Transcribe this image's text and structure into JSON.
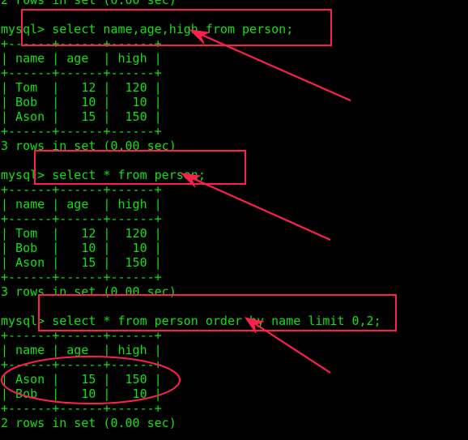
{
  "terminal": {
    "prompt": "mysql>",
    "partial_top_line": "2 rows in set (0.00 sec)",
    "queries": [
      {
        "command": "select name,age,high from person;",
        "columns": [
          "name",
          "age",
          "high"
        ],
        "rows": [
          [
            "Tom",
            "12",
            "120"
          ],
          [
            "Bob",
            "10",
            "10"
          ],
          [
            "Ason",
            "15",
            "150"
          ]
        ],
        "status": "3 rows in set (0.00 sec)"
      },
      {
        "command": "select * from person;",
        "columns": [
          "name",
          "age",
          "high"
        ],
        "rows": [
          [
            "Tom",
            "12",
            "120"
          ],
          [
            "Bob",
            "10",
            "10"
          ],
          [
            "Ason",
            "15",
            "150"
          ]
        ],
        "status": "3 rows in set (0.00 sec)"
      },
      {
        "command": "select * from person order by name limit 0,2;",
        "columns": [
          "name",
          "age",
          "high"
        ],
        "rows": [
          [
            "Ason",
            "15",
            "150"
          ],
          [
            "Bob",
            "10",
            "10"
          ]
        ],
        "status": "2 rows in set (0.00 sec)"
      }
    ]
  },
  "annotations": {
    "color": "#ff1f4f",
    "highlight_boxes": [
      "query-1-command",
      "query-2-command",
      "query-3-command"
    ],
    "arrows": [
      "arrow-to-query-1",
      "arrow-to-query-2",
      "arrow-to-query-3"
    ],
    "ellipse": "query-3-result-rows"
  }
}
